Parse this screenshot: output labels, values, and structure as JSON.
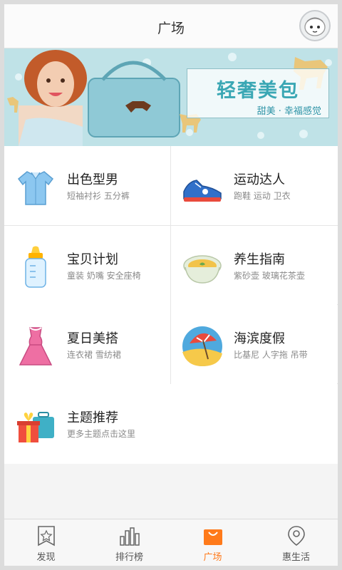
{
  "header": {
    "title": "广场"
  },
  "banner": {
    "title": "轻奢美包",
    "subtitle": "甜美 · 幸福感觉"
  },
  "categories": [
    {
      "title": "出色型男",
      "subtitle": "短袖衬衫 五分裤",
      "icon": "shirt-icon"
    },
    {
      "title": "运动达人",
      "subtitle": "跑鞋 运动 卫衣",
      "icon": "sneaker-icon"
    },
    {
      "title": "宝贝计划",
      "subtitle": "童装 奶嘴 安全座椅",
      "icon": "baby-bottle-icon"
    },
    {
      "title": "养生指南",
      "subtitle": "紫砂壶 玻璃花茶壶",
      "icon": "tea-bowl-icon"
    },
    {
      "title": "夏日美搭",
      "subtitle": "连衣裙 雪纺裙",
      "icon": "dress-icon"
    },
    {
      "title": "海滨度假",
      "subtitle": "比基尼 人字拖 吊带",
      "icon": "beach-umbrella-icon"
    },
    {
      "title": "主题推荐",
      "subtitle": "更多主题点击这里",
      "icon": "gift-luggage-icon"
    }
  ],
  "tabs": [
    {
      "label": "发现",
      "icon": "star-bookmark-icon"
    },
    {
      "label": "排行榜",
      "icon": "bar-chart-icon"
    },
    {
      "label": "广场",
      "icon": "shopping-bag-icon",
      "active": true
    },
    {
      "label": "惠生活",
      "icon": "location-pin-icon"
    }
  ],
  "colors": {
    "accent": "#ff7a1a",
    "banner": "#3aa7b4"
  }
}
